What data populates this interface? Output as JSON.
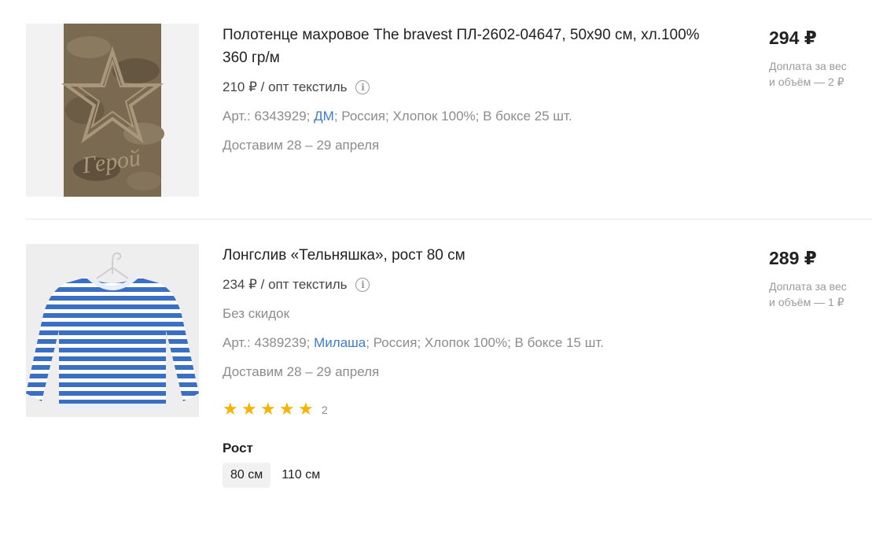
{
  "products": [
    {
      "title": "Полотенце махровое The bravest ПЛ-2602-04647, 50х90 см, хл.100% 360 гр/м",
      "wholesale": "210 ₽ / опт текстиль",
      "meta_pre": "Арт.: 6343929; ",
      "brand": "ДМ",
      "meta_post": "; Россия; Хлопок 100%; В боксе 25 шт.",
      "delivery": "Доставим 28 – 29 апреля",
      "price": "294 ₽",
      "surcharge_line1": "Доплата за вес",
      "surcharge_line2": "и объём — 2 ₽",
      "image_text": "Герой"
    },
    {
      "title": "Лонгслив «Тельняшка», рост 80 см",
      "wholesale": "234 ₽ / опт текстиль",
      "discount_note": "Без скидок",
      "meta_pre": "Арт.: 4389239; ",
      "brand": "Милаша",
      "meta_post": "; Россия; Хлопок 100%; В боксе 15 шт.",
      "delivery": "Доставим 28 – 29 апреля",
      "rating": 5,
      "reviews_count": "2",
      "price": "289 ₽",
      "surcharge_line1": "Доплата за вес",
      "surcharge_line2": "и объём — 1 ₽",
      "size_label": "Рост",
      "sizes": [
        "80 см",
        "110 см"
      ],
      "selected_size": "80 см"
    }
  ],
  "colors": {
    "link": "#3a7ec9",
    "star": "#f6b400",
    "muted": "#8c8c8c",
    "stripe_blue": "#3a6fc4"
  }
}
